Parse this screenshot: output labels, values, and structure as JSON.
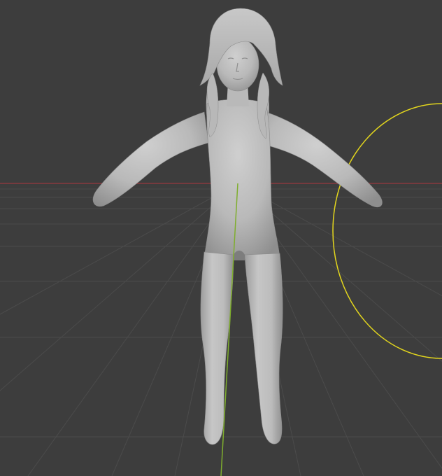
{
  "viewport": {
    "background_color": "#3d3d3d",
    "grid_color": "#4b4b4b",
    "x_axis_color": "#8a3a3f",
    "y_axis_color": "#7fae2e",
    "light_gizmo_color": "#e3d61d",
    "mesh_color": "#bdbdbd",
    "mesh_shadow_color": "#8f8f8f",
    "grid_visible": true,
    "object_type": "sculpted humanoid mesh in T-pose"
  }
}
